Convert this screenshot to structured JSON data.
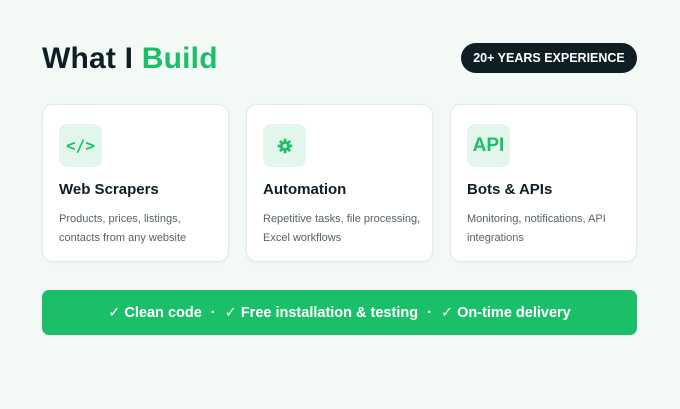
{
  "header": {
    "title_plain": "What I ",
    "title_accent": "Build",
    "badge": "20+ YEARS EXPERIENCE"
  },
  "cards": [
    {
      "icon": "code-icon",
      "icon_text": "</>",
      "title": "Web Scrapers",
      "description": "Products, prices, listings, contacts from any website"
    },
    {
      "icon": "gear-icon",
      "icon_text": "",
      "title": "Automation",
      "description": "Repetitive tasks, file processing, Excel workflows"
    },
    {
      "icon": "api-icon",
      "icon_text": "API",
      "title": "Bots & APIs",
      "description": "Monitoring, notifications, API integrations"
    }
  ],
  "banner": {
    "item_1": "✓ Clean code",
    "item_2": "✓ Free installation & testing",
    "item_3": "✓ On-time delivery",
    "separator": "·"
  },
  "colors": {
    "accent": "#1bbf6a",
    "dark": "#0f1e24",
    "background": "#f3faf6",
    "icon_background": "#e3f6ec"
  }
}
